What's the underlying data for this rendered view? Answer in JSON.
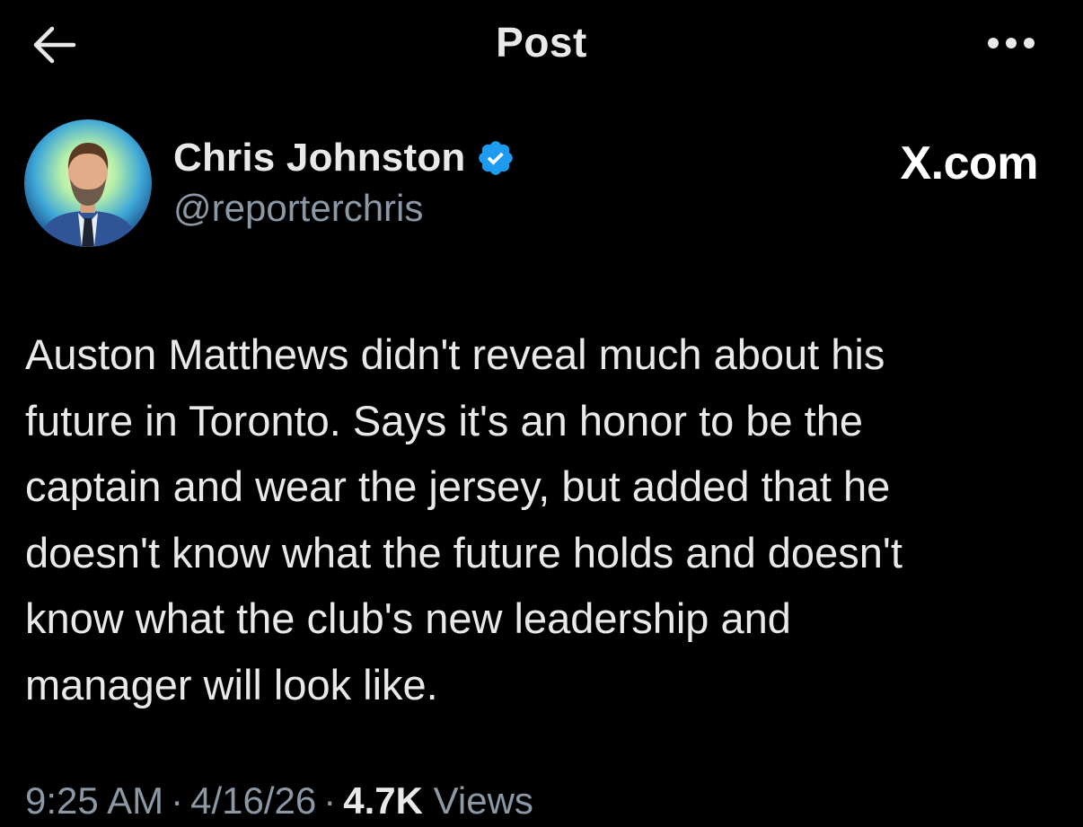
{
  "header": {
    "title": "Post",
    "back_icon": "arrow-left-icon",
    "more_icon": "more-horizontal-icon"
  },
  "author": {
    "display_name": "Chris Johnston",
    "handle": "@reporterchris",
    "verified": true,
    "verified_color": "#1d9bf0"
  },
  "watermark": "X.com",
  "tweet": {
    "text": "Auston Matthews didn't reveal much about  his\nfuture in Toronto. Says it's an honor to be the\ncaptain and wear the jersey, but added that he\ndoesn't know what the future holds and doesn't\nknow what the club's new leadership and\nmanager will look like."
  },
  "meta": {
    "time": "9:25 AM",
    "separator": "·",
    "date": "4/16/26",
    "views_count": "4.7K",
    "views_label": "Views"
  },
  "colors": {
    "background": "#000000",
    "primary_text": "#e7e9ea",
    "secondary_text": "#8b98a5",
    "accent": "#1d9bf0"
  }
}
